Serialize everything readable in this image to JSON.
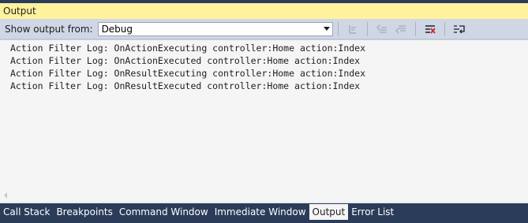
{
  "window": {
    "title": "Output"
  },
  "toolbar": {
    "label": "Show output from:",
    "source_value": "Debug",
    "buttons": [
      {
        "icon": "find-message-in-code-icon"
      },
      {
        "icon": "previous-message-icon"
      },
      {
        "icon": "next-message-icon"
      },
      {
        "icon": "clear-all-icon"
      },
      {
        "icon": "toggle-word-wrap-icon"
      }
    ]
  },
  "output": {
    "lines": [
      "Action Filter Log: OnActionExecuting controller:Home action:Index",
      "Action Filter Log: OnActionExecuted controller:Home action:Index",
      "Action Filter Log: OnResultExecuting controller:Home action:Index",
      "Action Filter Log: OnResultExecuted controller:Home action:Index"
    ]
  },
  "tabs": [
    {
      "label": "Call Stack",
      "active": false
    },
    {
      "label": "Breakpoints",
      "active": false
    },
    {
      "label": "Command Window",
      "active": false
    },
    {
      "label": "Immediate Window",
      "active": false
    },
    {
      "label": "Output",
      "active": true
    },
    {
      "label": "Error List",
      "active": false
    }
  ],
  "colors": {
    "title_bar": "#fff29d",
    "tab_strip": "#2b3c59",
    "active_tab": "#f5f5f5",
    "output_bg": "#f5f5f5"
  }
}
